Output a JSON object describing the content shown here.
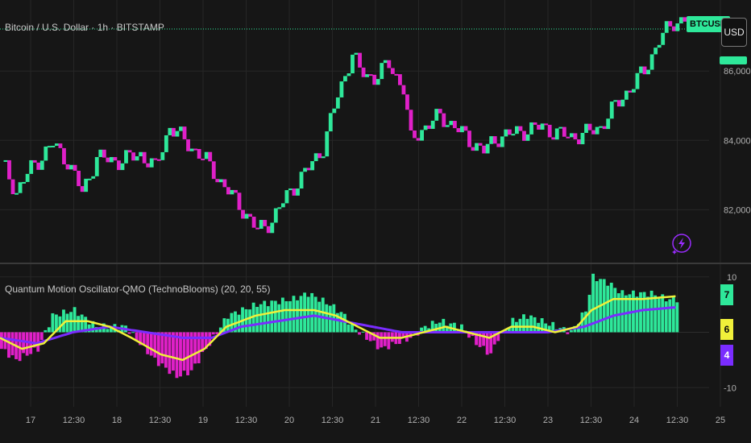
{
  "header": {
    "symbol_title": "Bitcoin / U.S. Dollar · 1h · BITSTAMP",
    "ticker_tag": "BTCUSD",
    "currency_button": "USD"
  },
  "oscillator": {
    "title": "Quantum Motion Oscillator-QMO (TechnoBlooms) (20, 20, 55)",
    "tags": [
      {
        "text": "7",
        "color": "#2ee89a",
        "text_color": "#0b0b0b"
      },
      {
        "text": "6",
        "color": "#f0f03a",
        "text_color": "#0b0b0b"
      },
      {
        "text": "4",
        "color": "#7a2cff",
        "text_color": "#ffffff"
      }
    ]
  },
  "colors": {
    "background": "#161616",
    "bull": "#2ee89a",
    "bear": "#e020c8",
    "signal_yellow": "#f0f03a",
    "signal_purple": "#7a2cff",
    "grid": "#262626"
  },
  "icons": [
    "lightning-icon"
  ],
  "chart_data": [
    {
      "type": "candlestick",
      "title": "Bitcoin / U.S. Dollar · 1h · BITSTAMP",
      "x_ticks": [
        "17",
        "12:30",
        "18",
        "12:30",
        "19",
        "12:30",
        "20",
        "12:30",
        "21",
        "12:30",
        "22",
        "12:30",
        "23",
        "12:30",
        "24",
        "12:30",
        "25"
      ],
      "y_ticks": [
        82000,
        84000,
        86000
      ],
      "y_range": [
        80500,
        87700
      ],
      "last_price_label": "BTCUSD",
      "close_path": [
        [
          0,
          83400
        ],
        [
          4,
          82500
        ],
        [
          8,
          83200
        ],
        [
          14,
          83900
        ],
        [
          18,
          83400
        ],
        [
          22,
          82500
        ],
        [
          26,
          83500
        ],
        [
          32,
          83400
        ],
        [
          38,
          83600
        ],
        [
          42,
          83200
        ],
        [
          46,
          84400
        ],
        [
          50,
          84000
        ],
        [
          56,
          83400
        ],
        [
          60,
          82800
        ],
        [
          66,
          82000
        ],
        [
          70,
          81400
        ],
        [
          74,
          81700
        ],
        [
          78,
          82400
        ],
        [
          84,
          83200
        ],
        [
          88,
          83800
        ],
        [
          92,
          85300
        ],
        [
          96,
          86500
        ],
        [
          98,
          86000
        ],
        [
          102,
          85800
        ],
        [
          106,
          86200
        ],
        [
          110,
          85500
        ],
        [
          112,
          84000
        ],
        [
          116,
          84400
        ],
        [
          120,
          84700
        ],
        [
          124,
          84400
        ],
        [
          128,
          84000
        ],
        [
          132,
          83700
        ],
        [
          136,
          84100
        ],
        [
          140,
          84200
        ],
        [
          144,
          84300
        ],
        [
          148,
          84400
        ],
        [
          152,
          84200
        ],
        [
          156,
          84100
        ],
        [
          160,
          84200
        ],
        [
          164,
          84400
        ],
        [
          168,
          85000
        ],
        [
          172,
          85500
        ],
        [
          176,
          86000
        ],
        [
          180,
          86900
        ],
        [
          184,
          87400
        ],
        [
          187,
          87500
        ]
      ]
    },
    {
      "type": "histogram",
      "title": "Quantum Motion Oscillator-QMO (TechnoBlooms) (20, 20, 55)",
      "y_ticks": [
        -10,
        10
      ],
      "y_range": [
        -12,
        12
      ],
      "series": [
        {
          "name": "",
          "color": "#2ee89a/#e020c8",
          "style": "histogram",
          "path": [
            [
              0,
              -3
            ],
            [
              4,
              -5
            ],
            [
              10,
              -3
            ],
            [
              14,
              3
            ],
            [
              20,
              4
            ],
            [
              26,
              1
            ],
            [
              34,
              1
            ],
            [
              38,
              -2
            ],
            [
              42,
              -5
            ],
            [
              48,
              -8
            ],
            [
              52,
              -7
            ],
            [
              56,
              -3
            ],
            [
              62,
              3
            ],
            [
              70,
              5
            ],
            [
              80,
              6
            ],
            [
              84,
              7
            ],
            [
              90,
              5
            ],
            [
              94,
              3
            ],
            [
              96,
              1
            ],
            [
              100,
              -1
            ],
            [
              104,
              -3
            ],
            [
              108,
              -2
            ],
            [
              112,
              -1
            ],
            [
              116,
              1
            ],
            [
              120,
              2
            ],
            [
              126,
              1
            ],
            [
              130,
              -2
            ],
            [
              134,
              -4
            ],
            [
              136,
              -1
            ],
            [
              140,
              2
            ],
            [
              144,
              3
            ],
            [
              148,
              2
            ],
            [
              152,
              1
            ],
            [
              156,
              0
            ],
            [
              160,
              4
            ],
            [
              162,
              10
            ],
            [
              166,
              9
            ],
            [
              170,
              7
            ],
            [
              174,
              7
            ],
            [
              178,
              7
            ],
            [
              182,
              6
            ],
            [
              185,
              6
            ]
          ]
        },
        {
          "name": "",
          "color": "#f0f03a",
          "style": "line",
          "path": [
            [
              0,
              -1
            ],
            [
              6,
              -3
            ],
            [
              12,
              -2
            ],
            [
              18,
              2
            ],
            [
              24,
              2
            ],
            [
              30,
              1
            ],
            [
              36,
              -1
            ],
            [
              44,
              -4
            ],
            [
              50,
              -5
            ],
            [
              56,
              -3
            ],
            [
              62,
              1
            ],
            [
              70,
              3
            ],
            [
              78,
              4
            ],
            [
              86,
              4
            ],
            [
              92,
              3
            ],
            [
              98,
              1
            ],
            [
              104,
              -1
            ],
            [
              110,
              -1
            ],
            [
              116,
              0
            ],
            [
              122,
              1
            ],
            [
              128,
              0
            ],
            [
              134,
              -1
            ],
            [
              140,
              1
            ],
            [
              146,
              1
            ],
            [
              152,
              0
            ],
            [
              158,
              1
            ],
            [
              162,
              4
            ],
            [
              168,
              6
            ],
            [
              176,
              6
            ],
            [
              185,
              6.5
            ]
          ]
        },
        {
          "name": "",
          "color": "#7a2cff",
          "style": "line",
          "path": [
            [
              0,
              -1
            ],
            [
              10,
              -2
            ],
            [
              20,
              0
            ],
            [
              30,
              1
            ],
            [
              40,
              0
            ],
            [
              50,
              -1
            ],
            [
              58,
              -1
            ],
            [
              66,
              1
            ],
            [
              76,
              2
            ],
            [
              86,
              3
            ],
            [
              94,
              2
            ],
            [
              102,
              1
            ],
            [
              110,
              0
            ],
            [
              120,
              0
            ],
            [
              130,
              0
            ],
            [
              140,
              0
            ],
            [
              150,
              0
            ],
            [
              160,
              1
            ],
            [
              168,
              3
            ],
            [
              176,
              4
            ],
            [
              185,
              4.5
            ]
          ]
        }
      ]
    }
  ]
}
